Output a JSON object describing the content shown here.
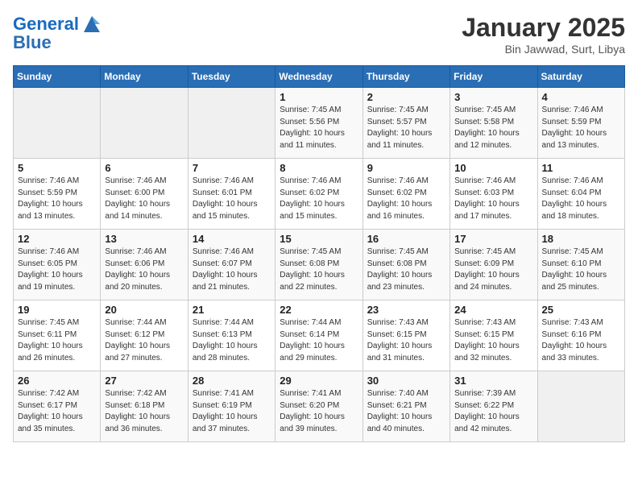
{
  "header": {
    "logo_line1": "General",
    "logo_line2": "Blue",
    "month": "January 2025",
    "location": "Bin Jawwad, Surt, Libya"
  },
  "weekdays": [
    "Sunday",
    "Monday",
    "Tuesday",
    "Wednesday",
    "Thursday",
    "Friday",
    "Saturday"
  ],
  "weeks": [
    [
      {
        "day": "",
        "info": ""
      },
      {
        "day": "",
        "info": ""
      },
      {
        "day": "",
        "info": ""
      },
      {
        "day": "1",
        "info": "Sunrise: 7:45 AM\nSunset: 5:56 PM\nDaylight: 10 hours\nand 11 minutes."
      },
      {
        "day": "2",
        "info": "Sunrise: 7:45 AM\nSunset: 5:57 PM\nDaylight: 10 hours\nand 11 minutes."
      },
      {
        "day": "3",
        "info": "Sunrise: 7:45 AM\nSunset: 5:58 PM\nDaylight: 10 hours\nand 12 minutes."
      },
      {
        "day": "4",
        "info": "Sunrise: 7:46 AM\nSunset: 5:59 PM\nDaylight: 10 hours\nand 13 minutes."
      }
    ],
    [
      {
        "day": "5",
        "info": "Sunrise: 7:46 AM\nSunset: 5:59 PM\nDaylight: 10 hours\nand 13 minutes."
      },
      {
        "day": "6",
        "info": "Sunrise: 7:46 AM\nSunset: 6:00 PM\nDaylight: 10 hours\nand 14 minutes."
      },
      {
        "day": "7",
        "info": "Sunrise: 7:46 AM\nSunset: 6:01 PM\nDaylight: 10 hours\nand 15 minutes."
      },
      {
        "day": "8",
        "info": "Sunrise: 7:46 AM\nSunset: 6:02 PM\nDaylight: 10 hours\nand 15 minutes."
      },
      {
        "day": "9",
        "info": "Sunrise: 7:46 AM\nSunset: 6:02 PM\nDaylight: 10 hours\nand 16 minutes."
      },
      {
        "day": "10",
        "info": "Sunrise: 7:46 AM\nSunset: 6:03 PM\nDaylight: 10 hours\nand 17 minutes."
      },
      {
        "day": "11",
        "info": "Sunrise: 7:46 AM\nSunset: 6:04 PM\nDaylight: 10 hours\nand 18 minutes."
      }
    ],
    [
      {
        "day": "12",
        "info": "Sunrise: 7:46 AM\nSunset: 6:05 PM\nDaylight: 10 hours\nand 19 minutes."
      },
      {
        "day": "13",
        "info": "Sunrise: 7:46 AM\nSunset: 6:06 PM\nDaylight: 10 hours\nand 20 minutes."
      },
      {
        "day": "14",
        "info": "Sunrise: 7:46 AM\nSunset: 6:07 PM\nDaylight: 10 hours\nand 21 minutes."
      },
      {
        "day": "15",
        "info": "Sunrise: 7:45 AM\nSunset: 6:08 PM\nDaylight: 10 hours\nand 22 minutes."
      },
      {
        "day": "16",
        "info": "Sunrise: 7:45 AM\nSunset: 6:08 PM\nDaylight: 10 hours\nand 23 minutes."
      },
      {
        "day": "17",
        "info": "Sunrise: 7:45 AM\nSunset: 6:09 PM\nDaylight: 10 hours\nand 24 minutes."
      },
      {
        "day": "18",
        "info": "Sunrise: 7:45 AM\nSunset: 6:10 PM\nDaylight: 10 hours\nand 25 minutes."
      }
    ],
    [
      {
        "day": "19",
        "info": "Sunrise: 7:45 AM\nSunset: 6:11 PM\nDaylight: 10 hours\nand 26 minutes."
      },
      {
        "day": "20",
        "info": "Sunrise: 7:44 AM\nSunset: 6:12 PM\nDaylight: 10 hours\nand 27 minutes."
      },
      {
        "day": "21",
        "info": "Sunrise: 7:44 AM\nSunset: 6:13 PM\nDaylight: 10 hours\nand 28 minutes."
      },
      {
        "day": "22",
        "info": "Sunrise: 7:44 AM\nSunset: 6:14 PM\nDaylight: 10 hours\nand 29 minutes."
      },
      {
        "day": "23",
        "info": "Sunrise: 7:43 AM\nSunset: 6:15 PM\nDaylight: 10 hours\nand 31 minutes."
      },
      {
        "day": "24",
        "info": "Sunrise: 7:43 AM\nSunset: 6:15 PM\nDaylight: 10 hours\nand 32 minutes."
      },
      {
        "day": "25",
        "info": "Sunrise: 7:43 AM\nSunset: 6:16 PM\nDaylight: 10 hours\nand 33 minutes."
      }
    ],
    [
      {
        "day": "26",
        "info": "Sunrise: 7:42 AM\nSunset: 6:17 PM\nDaylight: 10 hours\nand 35 minutes."
      },
      {
        "day": "27",
        "info": "Sunrise: 7:42 AM\nSunset: 6:18 PM\nDaylight: 10 hours\nand 36 minutes."
      },
      {
        "day": "28",
        "info": "Sunrise: 7:41 AM\nSunset: 6:19 PM\nDaylight: 10 hours\nand 37 minutes."
      },
      {
        "day": "29",
        "info": "Sunrise: 7:41 AM\nSunset: 6:20 PM\nDaylight: 10 hours\nand 39 minutes."
      },
      {
        "day": "30",
        "info": "Sunrise: 7:40 AM\nSunset: 6:21 PM\nDaylight: 10 hours\nand 40 minutes."
      },
      {
        "day": "31",
        "info": "Sunrise: 7:39 AM\nSunset: 6:22 PM\nDaylight: 10 hours\nand 42 minutes."
      },
      {
        "day": "",
        "info": ""
      }
    ]
  ]
}
